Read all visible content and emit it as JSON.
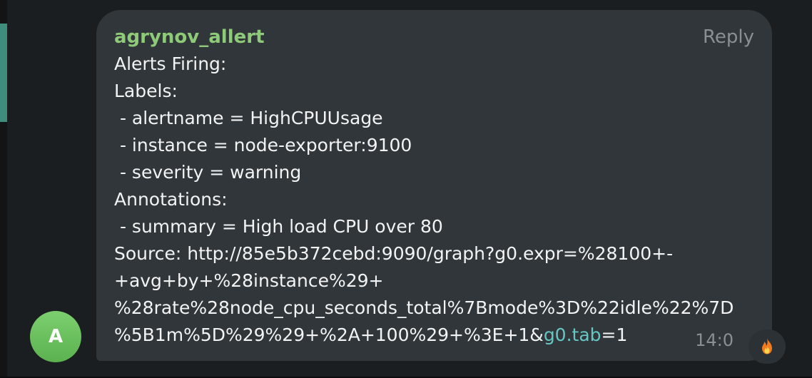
{
  "chat": {
    "avatar_initial": "A",
    "message": {
      "sender": "agrynov_allert",
      "reply_label": "Reply",
      "lines": [
        "Alerts Firing:",
        "Labels:",
        " - alertname = HighCPUUsage",
        " - instance = node-exporter:9100",
        " - severity = warning",
        "Annotations:",
        " - summary = High load CPU over 80",
        "Source: http://85e5b372cebd:9090/graph?g0.expr=%28100+-",
        "+avg+by+%28instance%29+",
        "%28rate%28node_cpu_seconds_total%7Bmode%3D%22idle%22%7D"
      ],
      "last_line_prefix": "%5B1m%5D%29%29+%2A+100%29+%3E+1&",
      "last_line_link": "g0.tab",
      "last_line_suffix": "=1",
      "time": "14:0",
      "reaction_icon": "fire-icon"
    },
    "colors": {
      "sender": "#8ecb78",
      "link": "#65c7c3",
      "bubble": "#31363a",
      "avatar": "#6cc05e"
    }
  }
}
